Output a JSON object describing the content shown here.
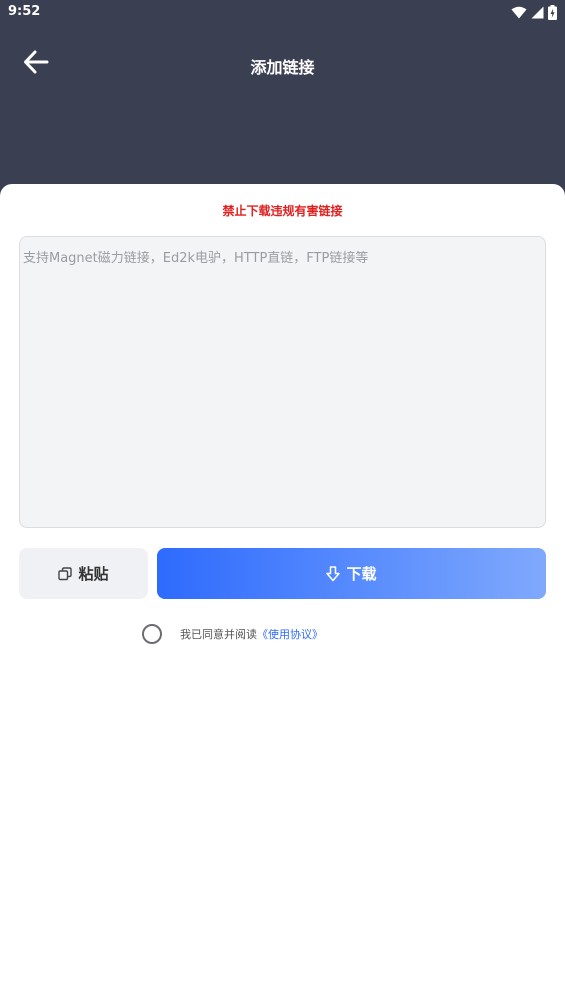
{
  "status_bar": {
    "time": "9:52",
    "icons": [
      "wifi-icon",
      "signal-icon",
      "battery-icon"
    ]
  },
  "header": {
    "title": "添加链接",
    "back_icon": "arrow-left-icon"
  },
  "warning": "禁止下载违规有害链接",
  "link_input": {
    "value": "",
    "placeholder": "支持Magnet磁力链接，Ed2k电驴，HTTP直链，FTP链接等"
  },
  "buttons": {
    "paste_label": "粘贴",
    "paste_icon": "copy-icon",
    "download_label": "下载",
    "download_icon": "download-arrow-icon"
  },
  "agreement": {
    "checked": false,
    "text": "我已同意并阅读",
    "link": "《使用协议》"
  },
  "colors": {
    "header_bg": "#3b3f52",
    "warning": "#e02020",
    "accent": "#2e6bfd",
    "accent_light": "#80a9fd"
  }
}
